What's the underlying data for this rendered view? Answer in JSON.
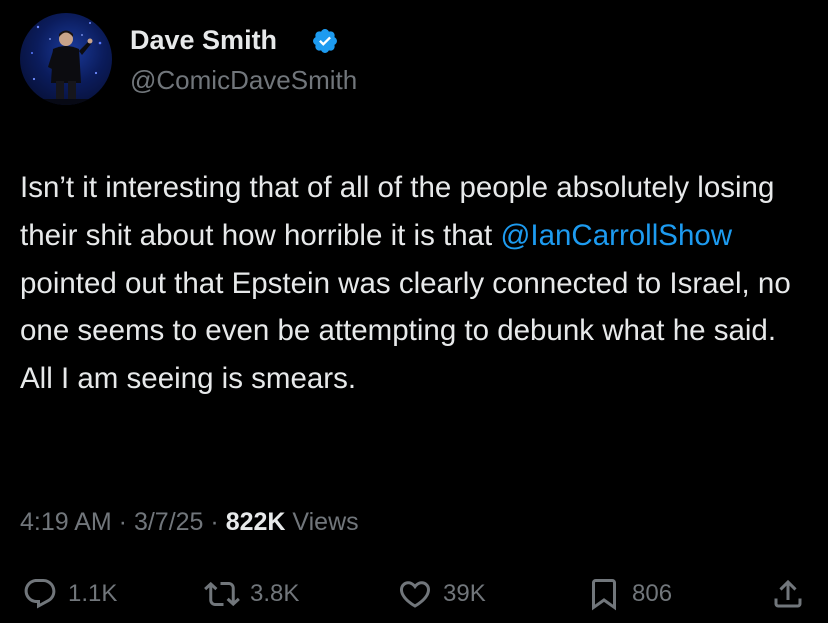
{
  "author": {
    "display_name": "Dave Smith",
    "handle": "@ComicDaveSmith",
    "verified": true,
    "verified_color": "#1d9bf0"
  },
  "tweet": {
    "text_before_mention": "Isn’t it interesting that of all of the people absolutely losing their shit about how horrible it is that ",
    "mention": "@IanCarrollShow",
    "text_after_mention": " pointed out that Epstein was clearly connected to Israel, no one seems to even be attempting to debunk what he said. All I am seeing is smears.",
    "mention_color": "#1d9bf0"
  },
  "meta": {
    "time": "4:19 AM",
    "separator": " · ",
    "date": "3/7/25",
    "views_count": "822K",
    "views_label": " Views"
  },
  "actions": {
    "replies": "1.1K",
    "reposts": "3.8K",
    "likes": "39K",
    "bookmarks": "806"
  },
  "icons": {
    "reply": "reply-icon",
    "repost": "repost-icon",
    "like": "heart-icon",
    "bookmark": "bookmark-icon",
    "share": "share-icon"
  }
}
